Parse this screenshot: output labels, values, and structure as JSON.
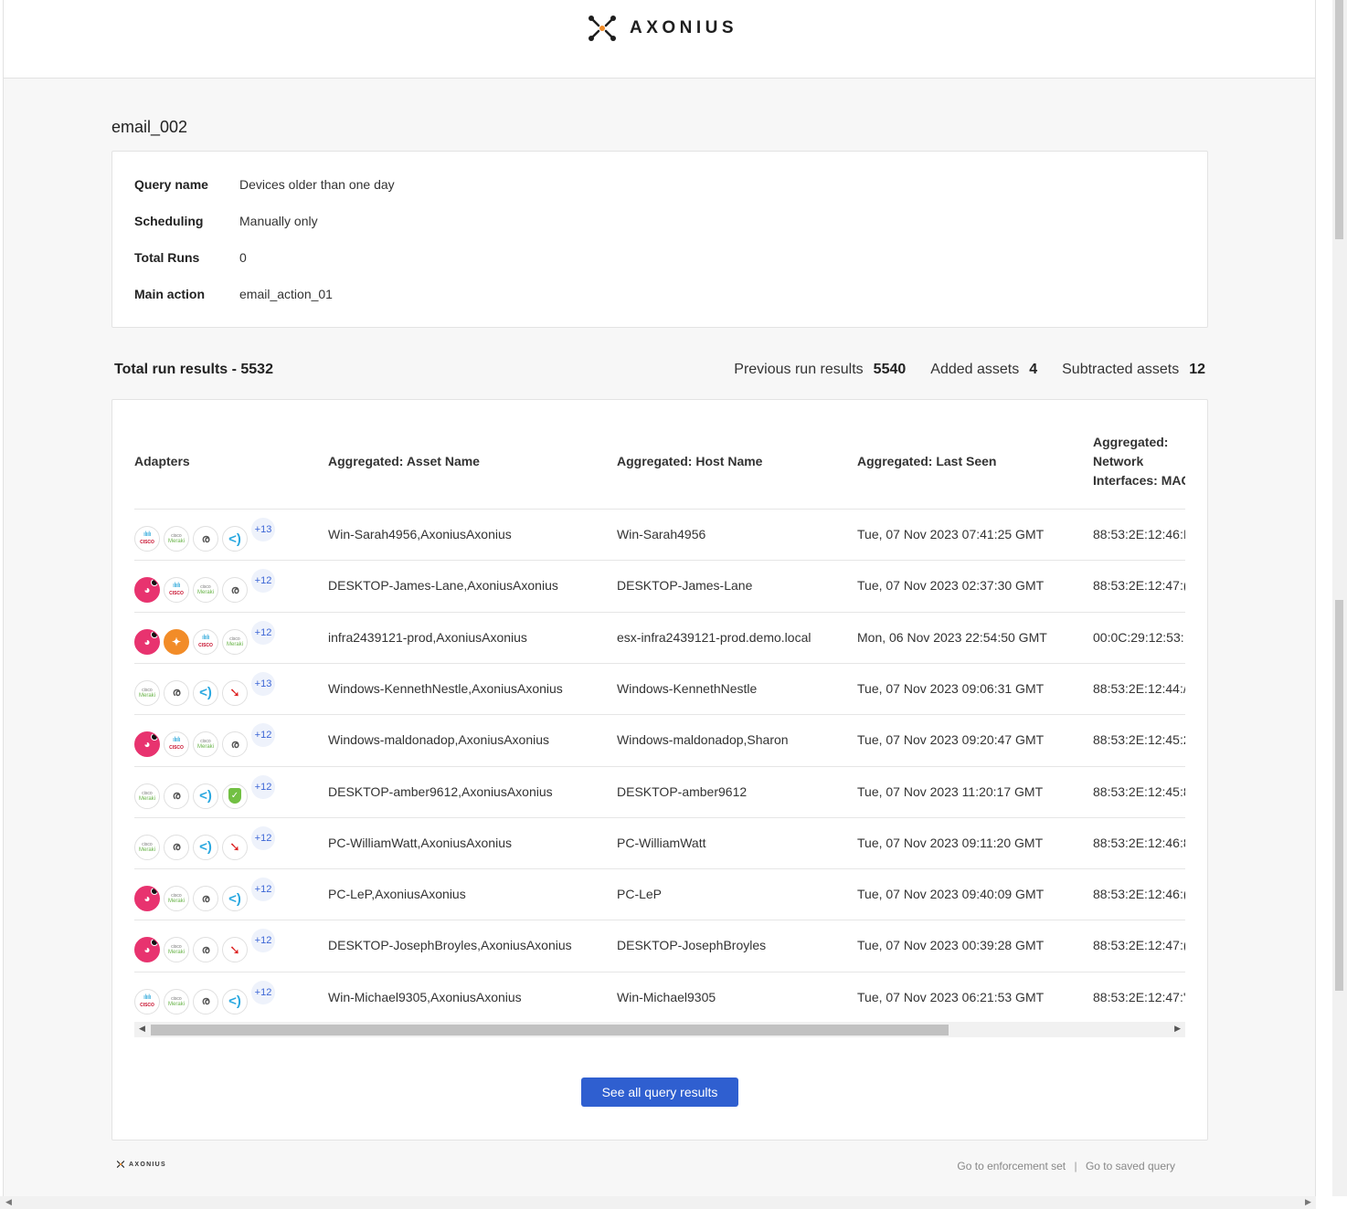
{
  "brand": {
    "name": "AXONIUS"
  },
  "page_title": "email_002",
  "info": [
    {
      "label": "Query name",
      "value": "Devices older than one day"
    },
    {
      "label": "Scheduling",
      "value": "Manually only"
    },
    {
      "label": "Total Runs",
      "value": "0"
    },
    {
      "label": "Main action",
      "value": "email_action_01"
    }
  ],
  "summary": {
    "total_label": "Total run results - 5532",
    "previous_label": "Previous run results",
    "previous_value": "5540",
    "added_label": "Added assets",
    "added_value": "4",
    "subtracted_label": "Subtracted assets",
    "subtracted_value": "12"
  },
  "table": {
    "columns": {
      "adapters": "Adapters",
      "asset_name": "Aggregated: Asset Name",
      "host_name": "Aggregated: Host Name",
      "last_seen": "Aggregated: Last Seen",
      "mac": "Aggregated: Network Interfaces: MAC"
    },
    "rows": [
      {
        "adapters": [
          "cisco",
          "meraki",
          "gray",
          "bracket"
        ],
        "more": "+13",
        "asset_name": "Win-Sarah4956,AxoniusAxonius",
        "host_name": "Win-Sarah4956",
        "last_seen": "Tue, 07 Nov 2023 07:41:25 GMT",
        "mac": "88:53:2E:12:46:I"
      },
      {
        "adapters": [
          "pink",
          "cisco",
          "meraki",
          "gray"
        ],
        "more": "+12",
        "asset_name": "DESKTOP-James-Lane,AxoniusAxonius",
        "host_name": "DESKTOP-James-Lane",
        "last_seen": "Tue, 07 Nov 2023 02:37:30 GMT",
        "mac": "88:53:2E:12:47:("
      },
      {
        "adapters": [
          "pink",
          "orange",
          "cisco",
          "meraki"
        ],
        "more": "+12",
        "asset_name": "infra2439121-prod,AxoniusAxonius",
        "host_name": "esx-infra2439121-prod.demo.local",
        "last_seen": "Mon, 06 Nov 2023 22:54:50 GMT",
        "mac": "00:0C:29:12:53:"
      },
      {
        "adapters": [
          "meraki",
          "gray",
          "bracket",
          "red"
        ],
        "more": "+13",
        "asset_name": "Windows-KennethNestle,AxoniusAxonius",
        "host_name": "Windows-KennethNestle",
        "last_seen": "Tue, 07 Nov 2023 09:06:31 GMT",
        "mac": "88:53:2E:12:44:/"
      },
      {
        "adapters": [
          "pink",
          "cisco",
          "meraki",
          "gray"
        ],
        "more": "+12",
        "asset_name": "Windows-maldonadop,AxoniusAxonius",
        "host_name": "Windows-maldonadop,Sharon",
        "last_seen": "Tue, 07 Nov 2023 09:20:47 GMT",
        "mac": "88:53:2E:12:45:2"
      },
      {
        "adapters": [
          "meraki",
          "gray",
          "bracket",
          "green"
        ],
        "more": "+12",
        "asset_name": "DESKTOP-amber9612,AxoniusAxonius",
        "host_name": "DESKTOP-amber9612",
        "last_seen": "Tue, 07 Nov 2023 11:20:17 GMT",
        "mac": "88:53:2E:12:45:8"
      },
      {
        "adapters": [
          "meraki",
          "gray",
          "bracket",
          "red"
        ],
        "more": "+12",
        "asset_name": "PC-WilliamWatt,AxoniusAxonius",
        "host_name": "PC-WilliamWatt",
        "last_seen": "Tue, 07 Nov 2023 09:11:20 GMT",
        "mac": "88:53:2E:12:46:8"
      },
      {
        "adapters": [
          "pink",
          "meraki",
          "gray",
          "bracket"
        ],
        "more": "+12",
        "asset_name": "PC-LeP,AxoniusAxonius",
        "host_name": "PC-LeP",
        "last_seen": "Tue, 07 Nov 2023 09:40:09 GMT",
        "mac": "88:53:2E:12:46:("
      },
      {
        "adapters": [
          "pink",
          "meraki",
          "gray",
          "red"
        ],
        "more": "+12",
        "asset_name": "DESKTOP-JosephBroyles,AxoniusAxonius",
        "host_name": "DESKTOP-JosephBroyles",
        "last_seen": "Tue, 07 Nov 2023 00:39:28 GMT",
        "mac": "88:53:2E:12:47:("
      },
      {
        "adapters": [
          "cisco",
          "meraki",
          "gray",
          "bracket"
        ],
        "more": "+12",
        "asset_name": "Win-Michael9305,AxoniusAxonius",
        "host_name": "Win-Michael9305",
        "last_seen": "Tue, 07 Nov 2023 06:21:53 GMT",
        "mac": "88:53:2E:12:47:'"
      }
    ]
  },
  "see_all_button": "See all query results",
  "footer": {
    "logo_text": "AXONIUS",
    "link_enforcement": "Go to enforcement set",
    "separator": "|",
    "link_saved_query": "Go to saved query"
  },
  "colors": {
    "primary": "#2f5fd0",
    "background": "#f7f7f7"
  }
}
